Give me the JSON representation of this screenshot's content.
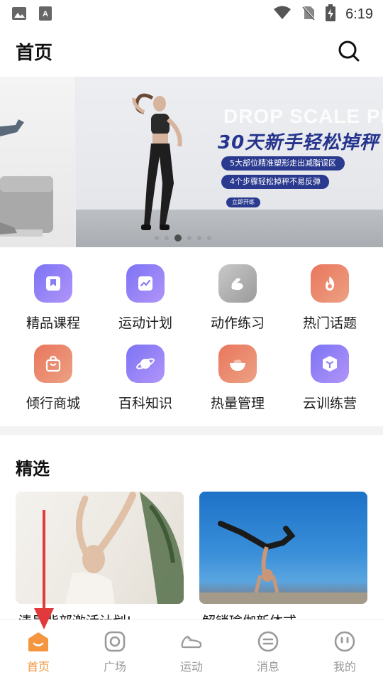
{
  "status_bar": {
    "time": "6:19",
    "icons": [
      "image-icon",
      "text-icon",
      "wifi-icon",
      "no-sim-icon",
      "battery-charging-icon"
    ]
  },
  "header": {
    "title": "首页",
    "search_icon": "search-icon"
  },
  "banner": {
    "bg_text": "DROP SCALE PLAN",
    "headline": "30天新手轻松掉秤",
    "pill1": "5大部位精准塑形走出减脂误区",
    "pill2": "4个步骤轻松掉秤不易反弹",
    "button": "立即开练",
    "slide_count": 6,
    "active_slide": 3
  },
  "grid": {
    "items": [
      {
        "label": "精品课程",
        "icon": "bookmark-icon",
        "color": "purple"
      },
      {
        "label": "运动计划",
        "icon": "chart-icon",
        "color": "purple"
      },
      {
        "label": "动作练习",
        "icon": "muscle-icon",
        "color": "grey"
      },
      {
        "label": "热门话题",
        "icon": "flame-icon",
        "color": "orange"
      },
      {
        "label": "倾行商城",
        "icon": "shopping-bag-icon",
        "color": "orange"
      },
      {
        "label": "百科知识",
        "icon": "planet-icon",
        "color": "purple"
      },
      {
        "label": "热量管理",
        "icon": "bowl-icon",
        "color": "orange"
      },
      {
        "label": "云训练营",
        "icon": "cube-icon",
        "color": "purple"
      }
    ]
  },
  "featured": {
    "title": "精选",
    "cards": [
      {
        "title": "清晨背部激活计划!"
      },
      {
        "title": "解锁瑜伽新体式"
      }
    ]
  },
  "bottom_nav": {
    "items": [
      {
        "label": "首页",
        "icon": "home-icon",
        "active": true
      },
      {
        "label": "广场",
        "icon": "square-icon",
        "active": false
      },
      {
        "label": "运动",
        "icon": "sneaker-icon",
        "active": false
      },
      {
        "label": "消息",
        "icon": "message-icon",
        "active": false
      },
      {
        "label": "我的",
        "icon": "profile-icon",
        "active": false
      }
    ]
  },
  "colors": {
    "accent": "#f3963f",
    "purple": "#8f80f6",
    "orange": "#e9765c",
    "annotation_arrow": "#e23a3a",
    "banner_text": "#25348c"
  }
}
